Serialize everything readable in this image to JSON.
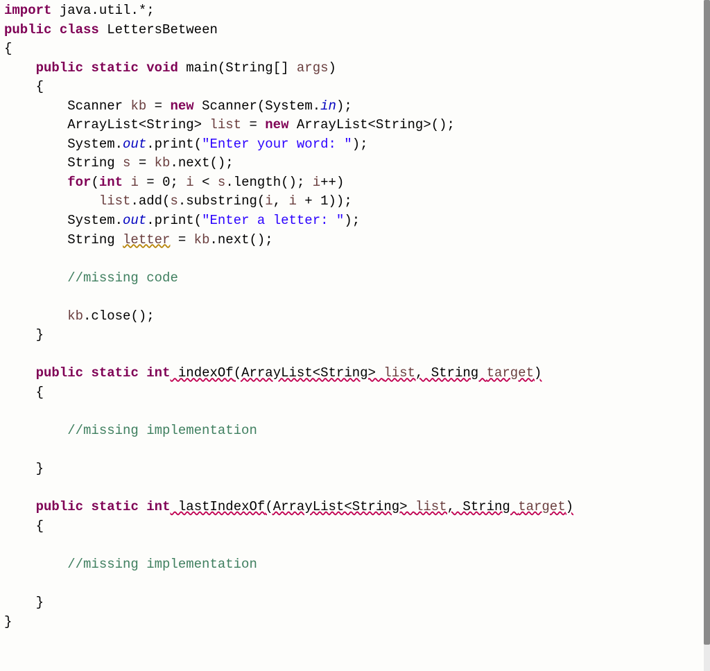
{
  "code": {
    "l1": {
      "kw1": "import",
      "pkg": " java.util.*;"
    },
    "l2": {
      "kw1": "public",
      "kw2": "class",
      "cls": " LettersBetween"
    },
    "l3": "{",
    "l4": {
      "kw1": "public",
      "kw2": "static",
      "kw3": "void",
      "name": " main(String[] ",
      "arg": "args",
      "close": ")"
    },
    "l5": "    {",
    "l6": {
      "a": "        Scanner ",
      "var": "kb",
      "b": " = ",
      "kw": "new",
      "c": " Scanner(System.",
      "fld": "in",
      "d": ");"
    },
    "l7": {
      "a": "        ArrayList<String> ",
      "var": "list",
      "b": " = ",
      "kw": "new",
      "c": " ArrayList<String>();"
    },
    "l8": {
      "a": "        System.",
      "fld": "out",
      "b": ".print(",
      "str": "\"Enter your word: \"",
      "c": ");"
    },
    "l9": {
      "a": "        String ",
      "var": "s",
      "b": " = ",
      "rhs": "kb",
      "c": ".next();"
    },
    "l10": {
      "a": "        ",
      "kw1": "for",
      "b": "(",
      "kw2": "int",
      "c": " ",
      "var": "i",
      "d": " = 0; ",
      "e": "i",
      "f": " < ",
      "g": "s",
      "h": ".length(); ",
      "i2": "i",
      "j": "++)"
    },
    "l11": {
      "a": "            ",
      "v1": "list",
      "b": ".add(",
      "v2": "s",
      "c": ".substring(",
      "v3": "i",
      "d": ", ",
      "v4": "i",
      "e": " + 1));"
    },
    "l12": {
      "a": "        System.",
      "fld": "out",
      "b": ".print(",
      "str": "\"Enter a letter: \"",
      "c": ");"
    },
    "l13": {
      "a": "        String ",
      "var": "letter",
      "b": " = ",
      "rhs": "kb",
      "c": ".next();"
    },
    "l14": "",
    "l15": {
      "a": "        ",
      "cmt": "//missing code"
    },
    "l16": "",
    "l17": {
      "a": "        ",
      "v": "kb",
      "b": ".close();"
    },
    "l18": "    }",
    "l19": "",
    "l20": {
      "kw1": "public",
      "kw2": "static",
      "kw3": "int",
      "name": " indexOf",
      "sig": "(ArrayList<String> ",
      "p1": "list",
      "mid": ", String ",
      "p2": "target",
      "close": ")"
    },
    "l21": "    {",
    "l22": "",
    "l23": {
      "a": "        ",
      "cmt": "//missing implementation"
    },
    "l24": "",
    "l25": "    }",
    "l26": "",
    "l27": {
      "kw1": "public",
      "kw2": "static",
      "kw3": "int",
      "name": " lastIndexOf",
      "sig": "(ArrayList<String> ",
      "p1": "list",
      "mid": ", String ",
      "p2": "target",
      "close": ")"
    },
    "l28": "    {",
    "l29": "",
    "l30": {
      "a": "        ",
      "cmt": "//missing implementation"
    },
    "l31": "",
    "l32": "    }",
    "l33": "}"
  }
}
